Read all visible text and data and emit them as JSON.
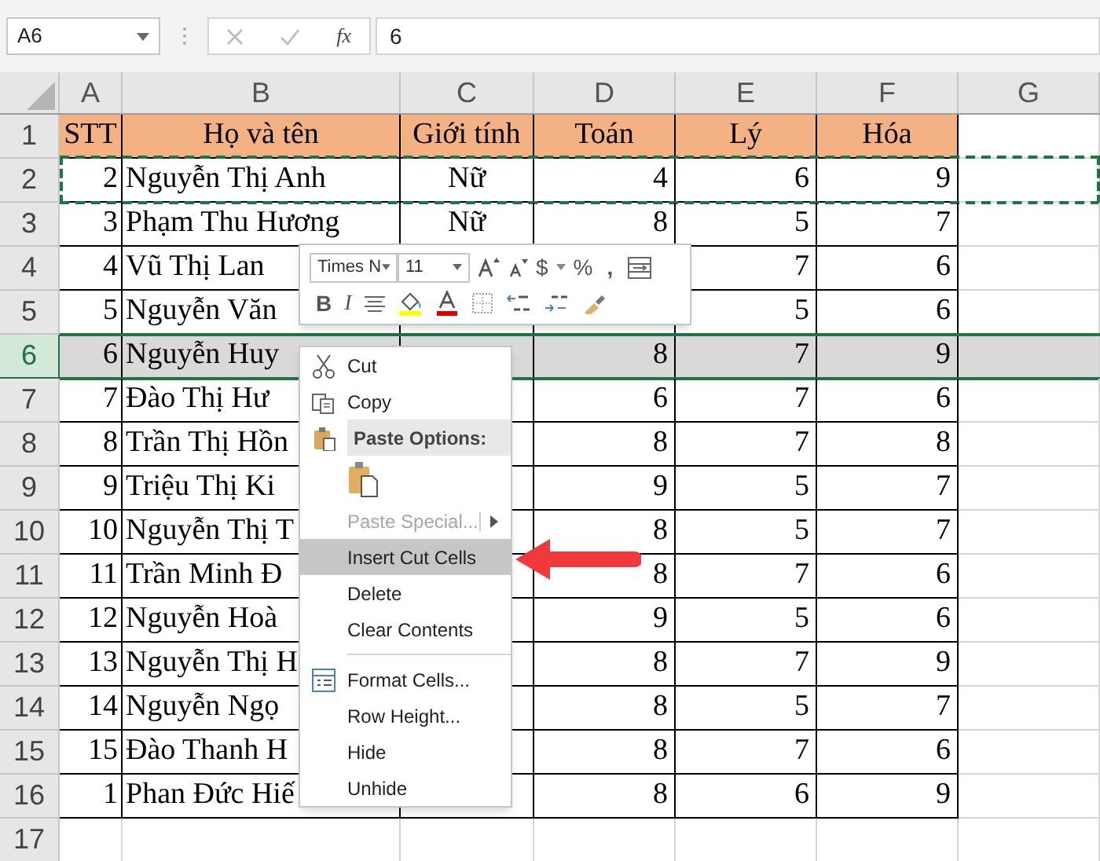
{
  "formula_bar": {
    "name_box": "A6",
    "fx": "fx",
    "value": "6"
  },
  "columns": [
    "A",
    "B",
    "C",
    "D",
    "E",
    "F",
    "G"
  ],
  "rows": [
    {
      "label": "1",
      "kind": "header",
      "selected": false,
      "cut": false,
      "cells": [
        "STT",
        "Họ và tên",
        "Giới tính",
        "Toán",
        "Lý",
        "Hóa"
      ]
    },
    {
      "label": "2",
      "kind": "data",
      "selected": false,
      "cut": true,
      "cells": [
        "2",
        "Nguyễn Thị Anh",
        "Nữ",
        "4",
        "6",
        "9"
      ]
    },
    {
      "label": "3",
      "kind": "data",
      "selected": false,
      "cut": false,
      "cells": [
        "3",
        "Phạm Thu Hương",
        "Nữ",
        "8",
        "5",
        "7"
      ]
    },
    {
      "label": "4",
      "kind": "data",
      "selected": false,
      "cut": false,
      "cells": [
        "4",
        "Vũ Thị Lan",
        null,
        null,
        "7",
        "6"
      ]
    },
    {
      "label": "5",
      "kind": "data",
      "selected": false,
      "cut": false,
      "cells": [
        "5",
        "Nguyễn Văn",
        null,
        null,
        "5",
        "6"
      ]
    },
    {
      "label": "6",
      "kind": "data",
      "selected": true,
      "cut": false,
      "cells": [
        "6",
        "Nguyễn Huy",
        null,
        "8",
        "7",
        "9"
      ]
    },
    {
      "label": "7",
      "kind": "data",
      "selected": false,
      "cut": false,
      "cells": [
        "7",
        "Đào Thị Hư",
        null,
        "6",
        "7",
        "6"
      ]
    },
    {
      "label": "8",
      "kind": "data",
      "selected": false,
      "cut": false,
      "cells": [
        "8",
        "Trần Thị Hồn",
        null,
        "8",
        "7",
        "8"
      ]
    },
    {
      "label": "9",
      "kind": "data",
      "selected": false,
      "cut": false,
      "cells": [
        "9",
        "Triệu Thị Ki",
        null,
        "9",
        "5",
        "7"
      ]
    },
    {
      "label": "10",
      "kind": "data",
      "selected": false,
      "cut": false,
      "cells": [
        "10",
        "Nguyễn Thị T",
        null,
        "8",
        "5",
        "7"
      ]
    },
    {
      "label": "11",
      "kind": "data",
      "selected": false,
      "cut": false,
      "cells": [
        "11",
        "Trần Minh Đ",
        null,
        "8",
        "7",
        "6"
      ]
    },
    {
      "label": "12",
      "kind": "data",
      "selected": false,
      "cut": false,
      "cells": [
        "12",
        "Nguyễn Hoà",
        null,
        "9",
        "5",
        "6"
      ]
    },
    {
      "label": "13",
      "kind": "data",
      "selected": false,
      "cut": false,
      "cells": [
        "13",
        "Nguyễn Thị H",
        null,
        "8",
        "7",
        "9"
      ]
    },
    {
      "label": "14",
      "kind": "data",
      "selected": false,
      "cut": false,
      "cells": [
        "14",
        "Nguyễn Ngọ",
        null,
        "8",
        "5",
        "7"
      ]
    },
    {
      "label": "15",
      "kind": "data",
      "selected": false,
      "cut": false,
      "cells": [
        "15",
        "Đào Thanh H",
        null,
        "8",
        "7",
        "6"
      ]
    },
    {
      "label": "16",
      "kind": "data",
      "selected": false,
      "cut": false,
      "cells": [
        "1",
        "Phan Đức Hiế",
        null,
        "8",
        "6",
        "9"
      ]
    },
    {
      "label": "17",
      "kind": "blank",
      "selected": false,
      "cut": false
    }
  ],
  "mini_toolbar": {
    "font": "Times N",
    "size": "11",
    "currency": "$",
    "percent": "%",
    "comma": ",",
    "bold": "B",
    "italic": "I"
  },
  "context_menu": {
    "items": [
      {
        "kind": "command",
        "label": "Cut",
        "selected": false,
        "disabled": false,
        "submenu": false
      },
      {
        "kind": "command",
        "label": "Copy",
        "selected": false,
        "disabled": false,
        "submenu": false
      },
      {
        "kind": "section",
        "label": "Paste Options:"
      },
      {
        "kind": "paste-buttons"
      },
      {
        "kind": "command",
        "label": "Paste Special...",
        "selected": false,
        "disabled": true,
        "submenu": true
      },
      {
        "kind": "command",
        "label": "Insert Cut Cells",
        "selected": true,
        "disabled": false,
        "submenu": false
      },
      {
        "kind": "command",
        "label": "Delete",
        "selected": false,
        "disabled": false,
        "submenu": false
      },
      {
        "kind": "command",
        "label": "Clear Contents",
        "selected": false,
        "disabled": false,
        "submenu": false
      },
      {
        "kind": "separator"
      },
      {
        "kind": "command",
        "label": "Format Cells...",
        "selected": false,
        "disabled": false,
        "submenu": false
      },
      {
        "kind": "command",
        "label": "Row Height...",
        "selected": false,
        "disabled": false,
        "submenu": false
      },
      {
        "kind": "command",
        "label": "Hide",
        "selected": false,
        "disabled": false,
        "submenu": false
      },
      {
        "kind": "command",
        "label": "Unhide",
        "selected": false,
        "disabled": false,
        "submenu": false
      }
    ]
  }
}
